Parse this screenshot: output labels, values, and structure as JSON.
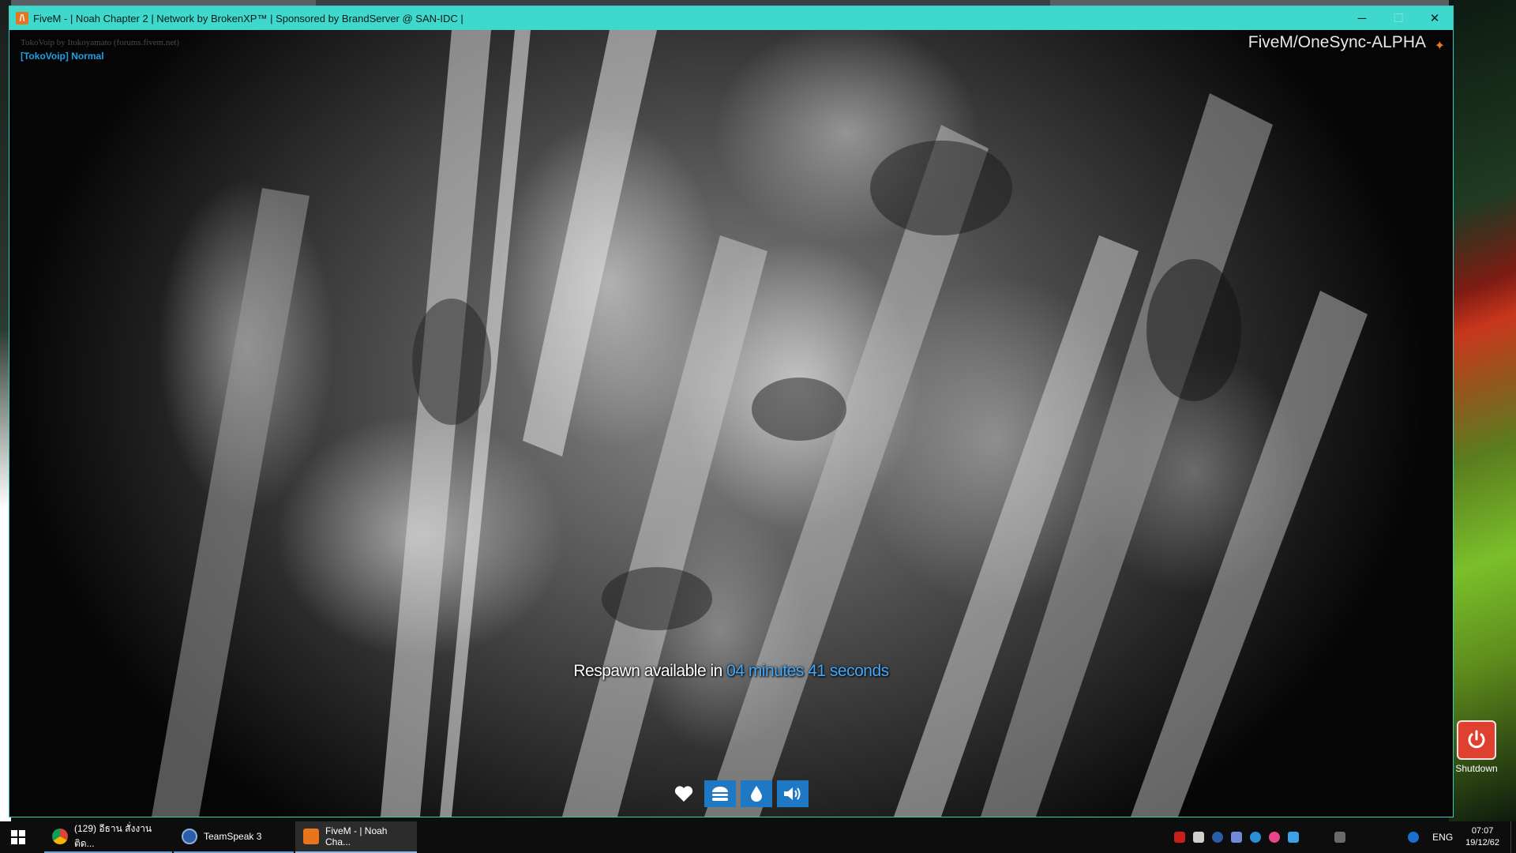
{
  "window": {
    "title": "FiveM - | Noah Chapter 2 | Network by BrokenXP™ | Sponsored by BrandServer @ SAN-IDC |",
    "controls": {
      "minimize": "─",
      "maximize": "☐",
      "close": "✕"
    }
  },
  "overlay": {
    "voip_credit": "TokoVoip by Itokoyamato (forums.fivem.net)",
    "voip_status": "[TokoVoip] Normal",
    "server_watermark": "FiveM/OneSync-ALPHA"
  },
  "respawn": {
    "prefix": "Respawn available in",
    "timer": "04 minutes 41 seconds"
  },
  "hud": {
    "items": [
      {
        "icon": "heart-icon"
      },
      {
        "icon": "burger-icon"
      },
      {
        "icon": "water-drop-icon"
      },
      {
        "icon": "speaker-icon"
      }
    ],
    "accent": "#1f78c4"
  },
  "desktop": {
    "shortcut_label": "Shutdown"
  },
  "taskbar": {
    "items": [
      {
        "label": "(129) อีธาน สั่งงานติด...",
        "icon": "chrome-icon"
      },
      {
        "label": "TeamSpeak 3",
        "icon": "teamspeak-icon"
      },
      {
        "label": "FiveM - | Noah Cha...",
        "icon": "fivem-icon"
      }
    ],
    "language": "ENG",
    "time": "07:07",
    "date": "19/12/62"
  },
  "colors": {
    "titlebar": "#3fd8cc",
    "voip_status": "#1fa0e6",
    "respawn_timer": "#3fa9ff"
  }
}
